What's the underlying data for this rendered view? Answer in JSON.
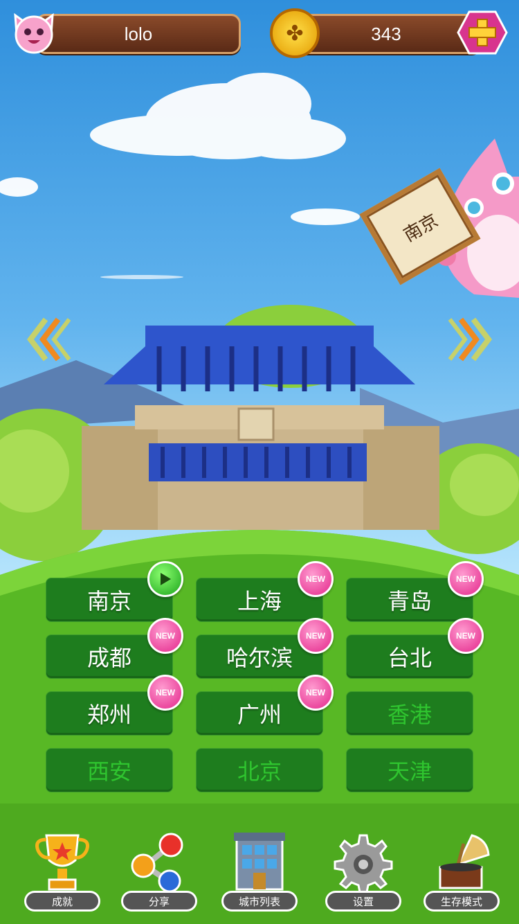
{
  "player": {
    "name": "lolo",
    "coins": "343"
  },
  "banner": {
    "city_sign": "南京"
  },
  "cities": [
    {
      "label": "南京",
      "badge": "play",
      "locked": false
    },
    {
      "label": "上海",
      "badge": "NEW",
      "locked": false
    },
    {
      "label": "青岛",
      "badge": "NEW",
      "locked": false
    },
    {
      "label": "成都",
      "badge": "NEW",
      "locked": false
    },
    {
      "label": "哈尔滨",
      "badge": "NEW",
      "locked": false
    },
    {
      "label": "台北",
      "badge": "NEW",
      "locked": false
    },
    {
      "label": "郑州",
      "badge": "NEW",
      "locked": false
    },
    {
      "label": "广州",
      "badge": "NEW",
      "locked": false
    },
    {
      "label": "香港",
      "badge": "",
      "locked": true
    },
    {
      "label": "西安",
      "badge": "",
      "locked": true
    },
    {
      "label": "北京",
      "badge": "",
      "locked": true
    },
    {
      "label": "天津",
      "badge": "",
      "locked": true
    }
  ],
  "nav": [
    {
      "label": "成就",
      "icon": "trophy-icon"
    },
    {
      "label": "分享",
      "icon": "share-icon"
    },
    {
      "label": "城市列表",
      "icon": "building-icon"
    },
    {
      "label": "设置",
      "icon": "gear-icon"
    },
    {
      "label": "生存模式",
      "icon": "gramophone-icon"
    }
  ],
  "colors": {
    "sky": "#2f8fdc",
    "grass": "#58b825",
    "city_button": "#1e7d1e",
    "new_badge": "#e3268a"
  }
}
